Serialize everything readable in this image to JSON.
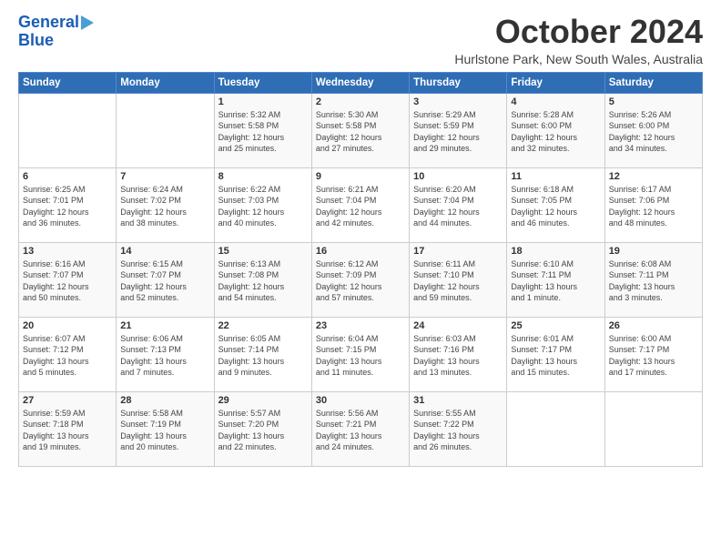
{
  "logo": {
    "line1": "General",
    "line2": "Blue"
  },
  "title": "October 2024",
  "subtitle": "Hurlstone Park, New South Wales, Australia",
  "days_of_week": [
    "Sunday",
    "Monday",
    "Tuesday",
    "Wednesday",
    "Thursday",
    "Friday",
    "Saturday"
  ],
  "weeks": [
    [
      {
        "day": "",
        "content": ""
      },
      {
        "day": "",
        "content": ""
      },
      {
        "day": "1",
        "content": "Sunrise: 5:32 AM\nSunset: 5:58 PM\nDaylight: 12 hours\nand 25 minutes."
      },
      {
        "day": "2",
        "content": "Sunrise: 5:30 AM\nSunset: 5:58 PM\nDaylight: 12 hours\nand 27 minutes."
      },
      {
        "day": "3",
        "content": "Sunrise: 5:29 AM\nSunset: 5:59 PM\nDaylight: 12 hours\nand 29 minutes."
      },
      {
        "day": "4",
        "content": "Sunrise: 5:28 AM\nSunset: 6:00 PM\nDaylight: 12 hours\nand 32 minutes."
      },
      {
        "day": "5",
        "content": "Sunrise: 5:26 AM\nSunset: 6:00 PM\nDaylight: 12 hours\nand 34 minutes."
      }
    ],
    [
      {
        "day": "6",
        "content": "Sunrise: 6:25 AM\nSunset: 7:01 PM\nDaylight: 12 hours\nand 36 minutes."
      },
      {
        "day": "7",
        "content": "Sunrise: 6:24 AM\nSunset: 7:02 PM\nDaylight: 12 hours\nand 38 minutes."
      },
      {
        "day": "8",
        "content": "Sunrise: 6:22 AM\nSunset: 7:03 PM\nDaylight: 12 hours\nand 40 minutes."
      },
      {
        "day": "9",
        "content": "Sunrise: 6:21 AM\nSunset: 7:04 PM\nDaylight: 12 hours\nand 42 minutes."
      },
      {
        "day": "10",
        "content": "Sunrise: 6:20 AM\nSunset: 7:04 PM\nDaylight: 12 hours\nand 44 minutes."
      },
      {
        "day": "11",
        "content": "Sunrise: 6:18 AM\nSunset: 7:05 PM\nDaylight: 12 hours\nand 46 minutes."
      },
      {
        "day": "12",
        "content": "Sunrise: 6:17 AM\nSunset: 7:06 PM\nDaylight: 12 hours\nand 48 minutes."
      }
    ],
    [
      {
        "day": "13",
        "content": "Sunrise: 6:16 AM\nSunset: 7:07 PM\nDaylight: 12 hours\nand 50 minutes."
      },
      {
        "day": "14",
        "content": "Sunrise: 6:15 AM\nSunset: 7:07 PM\nDaylight: 12 hours\nand 52 minutes."
      },
      {
        "day": "15",
        "content": "Sunrise: 6:13 AM\nSunset: 7:08 PM\nDaylight: 12 hours\nand 54 minutes."
      },
      {
        "day": "16",
        "content": "Sunrise: 6:12 AM\nSunset: 7:09 PM\nDaylight: 12 hours\nand 57 minutes."
      },
      {
        "day": "17",
        "content": "Sunrise: 6:11 AM\nSunset: 7:10 PM\nDaylight: 12 hours\nand 59 minutes."
      },
      {
        "day": "18",
        "content": "Sunrise: 6:10 AM\nSunset: 7:11 PM\nDaylight: 13 hours\nand 1 minute."
      },
      {
        "day": "19",
        "content": "Sunrise: 6:08 AM\nSunset: 7:11 PM\nDaylight: 13 hours\nand 3 minutes."
      }
    ],
    [
      {
        "day": "20",
        "content": "Sunrise: 6:07 AM\nSunset: 7:12 PM\nDaylight: 13 hours\nand 5 minutes."
      },
      {
        "day": "21",
        "content": "Sunrise: 6:06 AM\nSunset: 7:13 PM\nDaylight: 13 hours\nand 7 minutes."
      },
      {
        "day": "22",
        "content": "Sunrise: 6:05 AM\nSunset: 7:14 PM\nDaylight: 13 hours\nand 9 minutes."
      },
      {
        "day": "23",
        "content": "Sunrise: 6:04 AM\nSunset: 7:15 PM\nDaylight: 13 hours\nand 11 minutes."
      },
      {
        "day": "24",
        "content": "Sunrise: 6:03 AM\nSunset: 7:16 PM\nDaylight: 13 hours\nand 13 minutes."
      },
      {
        "day": "25",
        "content": "Sunrise: 6:01 AM\nSunset: 7:17 PM\nDaylight: 13 hours\nand 15 minutes."
      },
      {
        "day": "26",
        "content": "Sunrise: 6:00 AM\nSunset: 7:17 PM\nDaylight: 13 hours\nand 17 minutes."
      }
    ],
    [
      {
        "day": "27",
        "content": "Sunrise: 5:59 AM\nSunset: 7:18 PM\nDaylight: 13 hours\nand 19 minutes."
      },
      {
        "day": "28",
        "content": "Sunrise: 5:58 AM\nSunset: 7:19 PM\nDaylight: 13 hours\nand 20 minutes."
      },
      {
        "day": "29",
        "content": "Sunrise: 5:57 AM\nSunset: 7:20 PM\nDaylight: 13 hours\nand 22 minutes."
      },
      {
        "day": "30",
        "content": "Sunrise: 5:56 AM\nSunset: 7:21 PM\nDaylight: 13 hours\nand 24 minutes."
      },
      {
        "day": "31",
        "content": "Sunrise: 5:55 AM\nSunset: 7:22 PM\nDaylight: 13 hours\nand 26 minutes."
      },
      {
        "day": "",
        "content": ""
      },
      {
        "day": "",
        "content": ""
      }
    ]
  ]
}
